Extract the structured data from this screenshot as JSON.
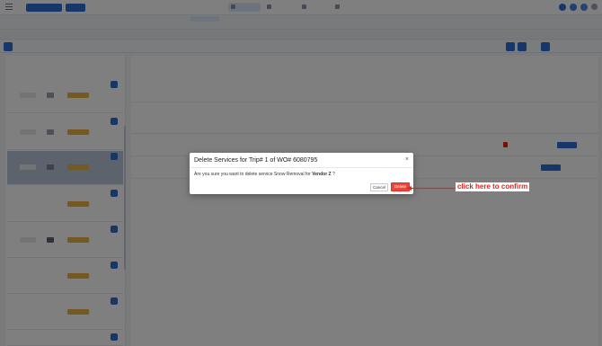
{
  "modal": {
    "title": "Delete Services for Trip# 1 of WO# 6080795",
    "close": "×",
    "body_prefix": "Are you sure you want to delete service Snow Removal for ",
    "vendor": "Vendor Z",
    "body_suffix": " ?",
    "cancel_label": "Cancel",
    "delete_label": "Delete"
  },
  "annotation": {
    "text": "click here to confirm",
    "color": "#e0261f"
  },
  "colors": {
    "accent": "#2f6fd6",
    "danger": "#f04438"
  }
}
